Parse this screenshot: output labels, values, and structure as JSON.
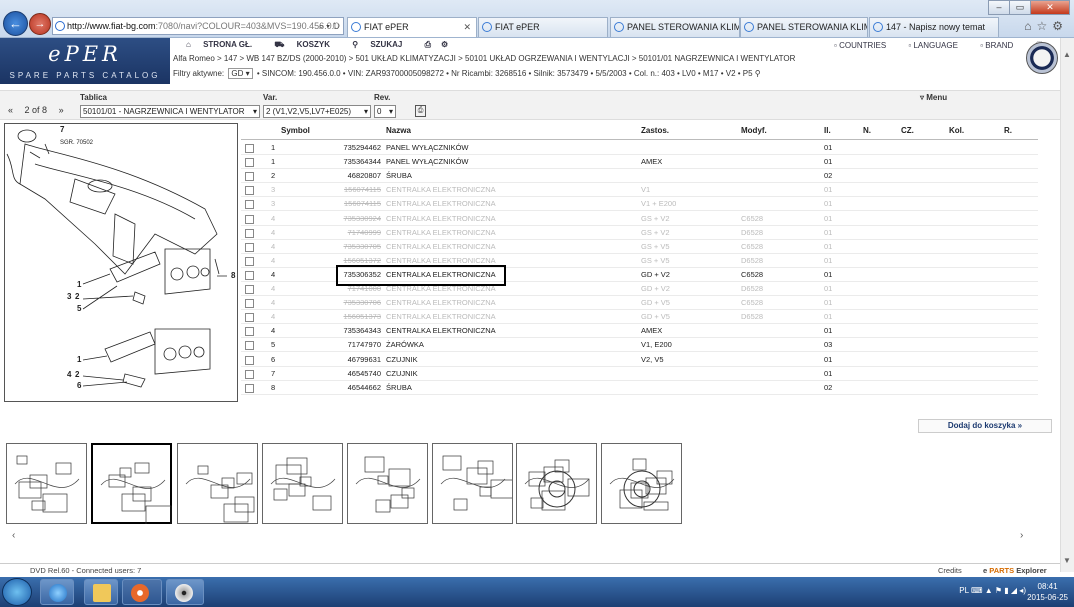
{
  "browser": {
    "url_host": "http://www.fiat-bg.com",
    "url_rest": ":7080/navi?COLOUR=403&MVS=190.456.0.0",
    "tabs": [
      {
        "label": "FIAT ePER",
        "active": true
      },
      {
        "label": "FIAT ePER",
        "active": false
      },
      {
        "label": "PANEL STEROWANIA KLIMAT...",
        "active": false
      },
      {
        "label": "PANEL STEROWANIA KLIMY ...",
        "active": false
      },
      {
        "label": "147 - Napisz nowy temat",
        "active": false
      }
    ]
  },
  "app": {
    "logo": "ePER",
    "catalog": "SPARE PARTS CATALOG",
    "nav": [
      "STRONA GŁ.",
      "KOSZYK",
      "SZUKAJ"
    ],
    "right_nav": [
      "COUNTRIES",
      "LANGUAGE",
      "BRAND"
    ],
    "breadcrumb": "Alfa Romeo > 147 > WB 147 BZ/DS (2000-2010) > 501 UKŁAD KLIMATYZACJI > 50101 UKŁAD OGRZEWANIA I WENTYLACJI > 50101/01 NAGRZEWNICA I WENTYLATOR",
    "filters_label": "Filtry aktywne:",
    "filters_value": "GD",
    "filters_rest": "• SINCOM: 190.456.0.0 • VIN: ZAR93700005098272 • Nr Ricambi: 3268516 • Silnik: 3573479 • 5/5/2003 • Col. n.: 403 • LV0 • M17 • V2 • P5"
  },
  "toolbar": {
    "tablica_label": "Tablica",
    "var_label": "Var.",
    "rev_label": "Rev.",
    "menu_label": "Menu",
    "page": "2 of 8",
    "tablica_value": "50101/01 - NAGRZEWNICA I WENTYLATOR",
    "var_value": "2 (V1,V2,V5,LV7+E025)",
    "rev_value": "0"
  },
  "diagram": {
    "label": "SGR. 70502",
    "callouts": [
      "7",
      "1",
      "3",
      "2",
      "5",
      "8",
      "1",
      "4",
      "2",
      "6"
    ]
  },
  "table": {
    "headers": [
      "Symbol",
      "Nazwa",
      "Zastos.",
      "Modyf.",
      "Il.",
      "N.",
      "CZ.",
      "Kol.",
      "R."
    ],
    "rows": [
      {
        "sym": "1",
        "code": "735294462",
        "name": "PANEL WYŁĄCZNIKÓW",
        "zast": "",
        "mod": "",
        "il": "01",
        "dim": false
      },
      {
        "sym": "1",
        "code": "735364344",
        "name": "PANEL WYŁĄCZNIKÓW",
        "zast": "AMEX",
        "mod": "",
        "il": "01",
        "dim": false
      },
      {
        "sym": "2",
        "code": "46820807",
        "name": "ŚRUBA",
        "zast": "",
        "mod": "",
        "il": "02",
        "dim": false
      },
      {
        "sym": "3",
        "code": "156074115",
        "name": "CENTRALKA ELEKTRONICZNA",
        "zast": "V1",
        "mod": "",
        "il": "01",
        "dim": true
      },
      {
        "sym": "3",
        "code": "156074115",
        "name": "CENTRALKA ELEKTRONICZNA",
        "zast": "V1 + E200",
        "mod": "",
        "il": "01",
        "dim": true
      },
      {
        "sym": "4",
        "code": "735330924",
        "name": "CENTRALKA ELEKTRONICZNA",
        "zast": "GS + V2",
        "mod": "C6528",
        "il": "01",
        "dim": true
      },
      {
        "sym": "4",
        "code": "71740999",
        "name": "CENTRALKA ELEKTRONICZNA",
        "zast": "GS + V2",
        "mod": "D6528",
        "il": "01",
        "dim": true
      },
      {
        "sym": "4",
        "code": "735330705",
        "name": "CENTRALKA ELEKTRONICZNA",
        "zast": "GS + V5",
        "mod": "C6528",
        "il": "01",
        "dim": true
      },
      {
        "sym": "4",
        "code": "156051372",
        "name": "CENTRALKA ELEKTRONICZNA",
        "zast": "GS + V5",
        "mod": "D6528",
        "il": "01",
        "dim": true
      },
      {
        "sym": "4",
        "code": "735306352",
        "name": "CENTRALKA ELEKTRONICZNA",
        "zast": "GD + V2",
        "mod": "C6528",
        "il": "01",
        "dim": false
      },
      {
        "sym": "4",
        "code": "71741000",
        "name": "CENTRALKA ELEKTRONICZNA",
        "zast": "GD + V2",
        "mod": "D6528",
        "il": "01",
        "dim": true
      },
      {
        "sym": "4",
        "code": "735330706",
        "name": "CENTRALKA ELEKTRONICZNA",
        "zast": "GD + V5",
        "mod": "C6528",
        "il": "01",
        "dim": true
      },
      {
        "sym": "4",
        "code": "156051373",
        "name": "CENTRALKA ELEKTRONICZNA",
        "zast": "GD + V5",
        "mod": "D6528",
        "il": "01",
        "dim": true
      },
      {
        "sym": "4",
        "code": "735364343",
        "name": "CENTRALKA ELEKTRONICZNA",
        "zast": "AMEX",
        "mod": "",
        "il": "01",
        "dim": false
      },
      {
        "sym": "5",
        "code": "71747970",
        "name": "ŻARÓWKA",
        "zast": "V1, E200",
        "mod": "",
        "il": "03",
        "dim": false
      },
      {
        "sym": "6",
        "code": "46799631",
        "name": "CZUJNIK",
        "zast": "V2, V5",
        "mod": "",
        "il": "01",
        "dim": false
      },
      {
        "sym": "7",
        "code": "46545740",
        "name": "CZUJNIK",
        "zast": "",
        "mod": "",
        "il": "01",
        "dim": false
      },
      {
        "sym": "8",
        "code": "46544662",
        "name": "ŚRUBA",
        "zast": "",
        "mod": "",
        "il": "02",
        "dim": false
      }
    ]
  },
  "cart": {
    "label": "Dodaj do koszyka »"
  },
  "status": {
    "dvd": "DVD Rel.60  -  Connected users: 7",
    "credits": "Credits",
    "parts_brand": "PARTS",
    "parts_suffix": " Explorer"
  },
  "taskbar": {
    "tray_lang": "PL",
    "time": "08:41",
    "date": "2015-06-25"
  },
  "colors": {
    "logo_bg": "#1b3463",
    "accent": "#1c3a70"
  }
}
